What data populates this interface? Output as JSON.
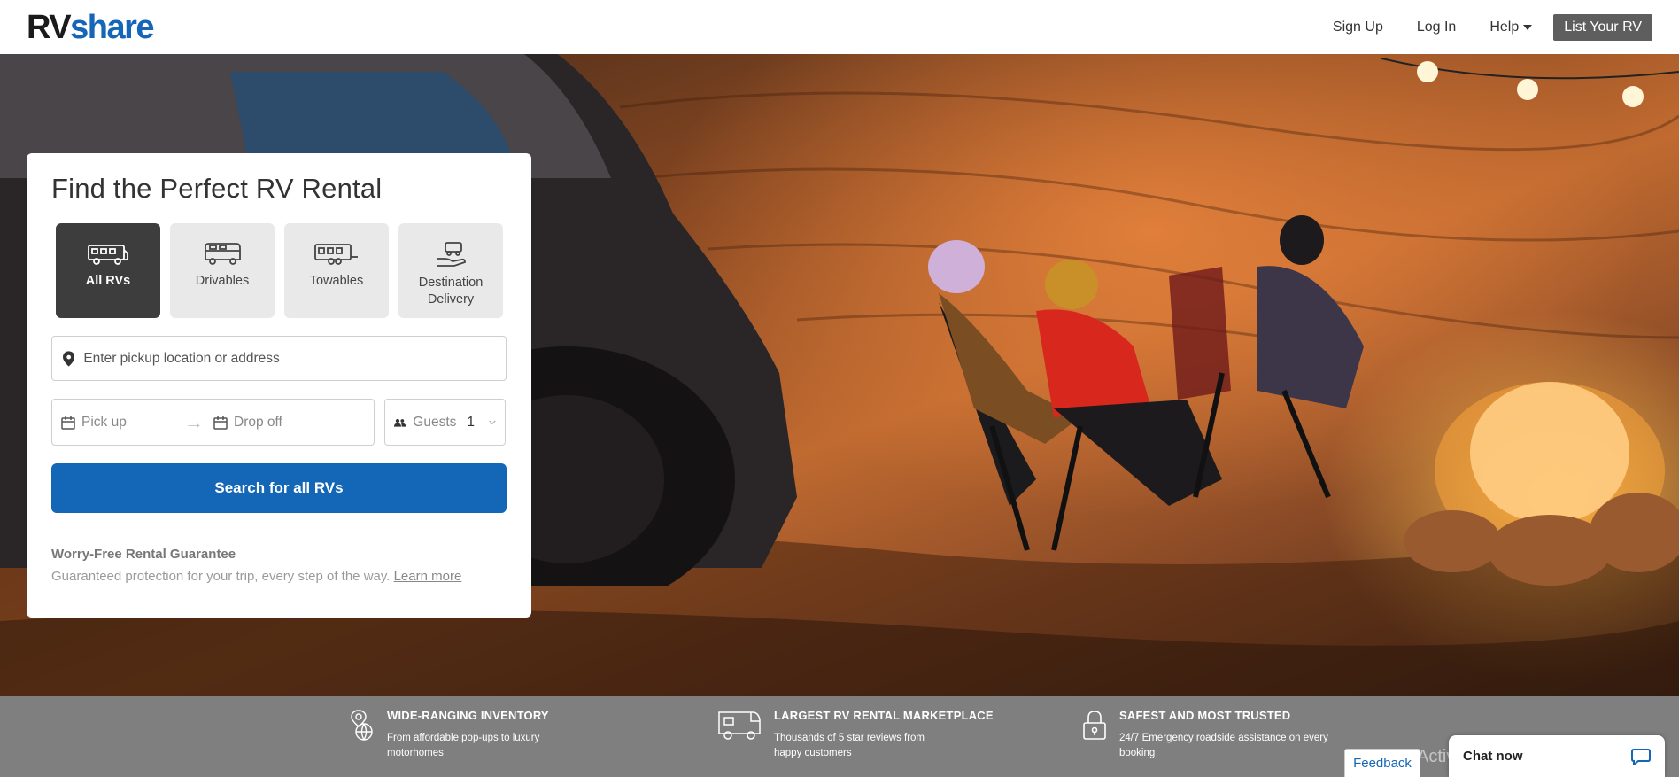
{
  "header": {
    "logo_rv": "RV",
    "logo_share": "share",
    "nav": {
      "signup": "Sign Up",
      "login": "Log In",
      "help": "Help",
      "list_rv": "List Your RV"
    }
  },
  "search": {
    "title": "Find the Perfect RV Rental",
    "types": [
      {
        "label": "All RVs",
        "icon": "all-rvs-icon",
        "active": true
      },
      {
        "label": "Drivables",
        "icon": "drivable-icon",
        "active": false
      },
      {
        "label": "Towables",
        "icon": "towable-icon",
        "active": false
      },
      {
        "label": "Destination Delivery",
        "icon": "delivery-icon",
        "active": false
      }
    ],
    "location_placeholder": "Enter pickup location or address",
    "pickup_placeholder": "Pick up",
    "dropoff_placeholder": "Drop off",
    "guests_label": "Guests",
    "guests_value": "1",
    "button": "Search for all RVs",
    "guarantee_title": "Worry-Free Rental Guarantee",
    "guarantee_text": "Guaranteed protection for your trip, every step of the way.",
    "learn_more": "Learn more"
  },
  "features": [
    {
      "icon": "globe-pin-icon",
      "title": "WIDE-RANGING INVENTORY",
      "text": "From affordable pop-ups to luxury motorhomes"
    },
    {
      "icon": "rv-icon",
      "title": "LARGEST RV RENTAL MARKETPLACE",
      "text": "Thousands of 5 star reviews from happy customers"
    },
    {
      "icon": "lock-icon",
      "title": "SAFEST AND MOST TRUSTED",
      "text": "24/7 Emergency roadside assistance on every booking"
    }
  ],
  "feedback": "Feedback",
  "chat": "Chat now",
  "watermark": "Activate Windows",
  "colors": {
    "brand": "#1565b8",
    "button": "#1467b6",
    "strip": "#7f7f7f"
  }
}
